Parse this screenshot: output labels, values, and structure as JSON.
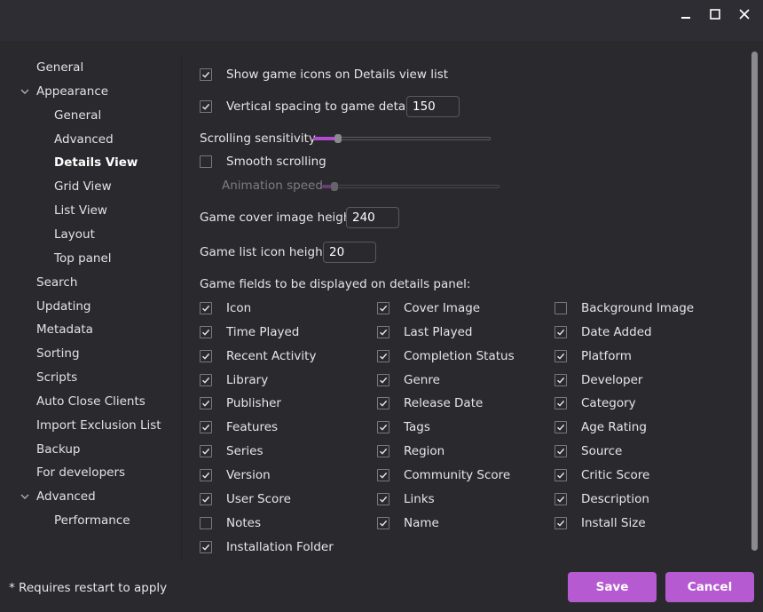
{
  "window": {
    "buttons": [
      {
        "name": "minimize-button",
        "icon": "minimize-icon"
      },
      {
        "name": "maximize-button",
        "icon": "maximize-icon"
      },
      {
        "name": "close-button",
        "icon": "close-icon"
      }
    ]
  },
  "sidebar": {
    "items": [
      {
        "label": "General",
        "level": 0,
        "expander": false
      },
      {
        "label": "Appearance",
        "level": 0,
        "expander": true
      },
      {
        "label": "General",
        "level": 1,
        "expander": false
      },
      {
        "label": "Advanced",
        "level": 1,
        "expander": false
      },
      {
        "label": "Details View",
        "level": 1,
        "expander": false,
        "selected": true
      },
      {
        "label": "Grid View",
        "level": 1,
        "expander": false
      },
      {
        "label": "List View",
        "level": 1,
        "expander": false
      },
      {
        "label": "Layout",
        "level": 1,
        "expander": false
      },
      {
        "label": "Top panel",
        "level": 1,
        "expander": false
      },
      {
        "label": "Search",
        "level": 0,
        "expander": false
      },
      {
        "label": "Updating",
        "level": 0,
        "expander": false
      },
      {
        "label": "Metadata",
        "level": 0,
        "expander": false
      },
      {
        "label": "Sorting",
        "level": 0,
        "expander": false
      },
      {
        "label": "Scripts",
        "level": 0,
        "expander": false
      },
      {
        "label": "Auto Close Clients",
        "level": 0,
        "expander": false
      },
      {
        "label": "Import Exclusion List",
        "level": 0,
        "expander": false
      },
      {
        "label": "Backup",
        "level": 0,
        "expander": false
      },
      {
        "label": "For developers",
        "level": 0,
        "expander": false
      },
      {
        "label": "Advanced",
        "level": 0,
        "expander": true
      },
      {
        "label": "Performance",
        "level": 1,
        "expander": false
      }
    ]
  },
  "settings": {
    "show_icons": {
      "label": "Show game icons on Details view list",
      "checked": true
    },
    "vertical_spacing": {
      "label": "Vertical spacing to game details",
      "checked": true,
      "value": "150"
    },
    "scrolling_sensitivity": {
      "label": "Scrolling sensitivity",
      "level": 0.13
    },
    "smooth_scrolling": {
      "label": "Smooth scrolling",
      "checked": false
    },
    "animation_speed": {
      "label": "Animation speed",
      "level": 0.06
    },
    "cover_height": {
      "label": "Game cover image height",
      "value": "240"
    },
    "list_icon_height": {
      "label": "Game list icon height",
      "value": "20"
    },
    "fields_heading": "Game fields to be displayed on details panel:"
  },
  "fields": [
    {
      "label": "Icon",
      "checked": true
    },
    {
      "label": "Cover Image",
      "checked": true
    },
    {
      "label": "Background Image",
      "checked": false
    },
    {
      "label": "Time Played",
      "checked": true
    },
    {
      "label": "Last Played",
      "checked": true
    },
    {
      "label": "Date Added",
      "checked": true
    },
    {
      "label": "Recent Activity",
      "checked": true
    },
    {
      "label": "Completion Status",
      "checked": true
    },
    {
      "label": "Platform",
      "checked": true
    },
    {
      "label": "Library",
      "checked": true
    },
    {
      "label": "Genre",
      "checked": true
    },
    {
      "label": "Developer",
      "checked": true
    },
    {
      "label": "Publisher",
      "checked": true
    },
    {
      "label": "Release Date",
      "checked": true
    },
    {
      "label": "Category",
      "checked": true
    },
    {
      "label": "Features",
      "checked": true
    },
    {
      "label": "Tags",
      "checked": true
    },
    {
      "label": "Age Rating",
      "checked": true
    },
    {
      "label": "Series",
      "checked": true
    },
    {
      "label": "Region",
      "checked": true
    },
    {
      "label": "Source",
      "checked": true
    },
    {
      "label": "Version",
      "checked": true
    },
    {
      "label": "Community Score",
      "checked": true
    },
    {
      "label": "Critic Score",
      "checked": true
    },
    {
      "label": "User Score",
      "checked": true
    },
    {
      "label": "Links",
      "checked": true
    },
    {
      "label": "Description",
      "checked": true
    },
    {
      "label": "Notes",
      "checked": false
    },
    {
      "label": "Name",
      "checked": true
    },
    {
      "label": "Install Size",
      "checked": true
    },
    {
      "label": "Installation Folder",
      "checked": true
    }
  ],
  "footer": {
    "note": "* Requires restart to apply",
    "save_label": "Save",
    "cancel_label": "Cancel"
  },
  "colors": {
    "accent": "#b65ad2",
    "background": "#2a292e",
    "titlebar": "#2e2d33"
  }
}
